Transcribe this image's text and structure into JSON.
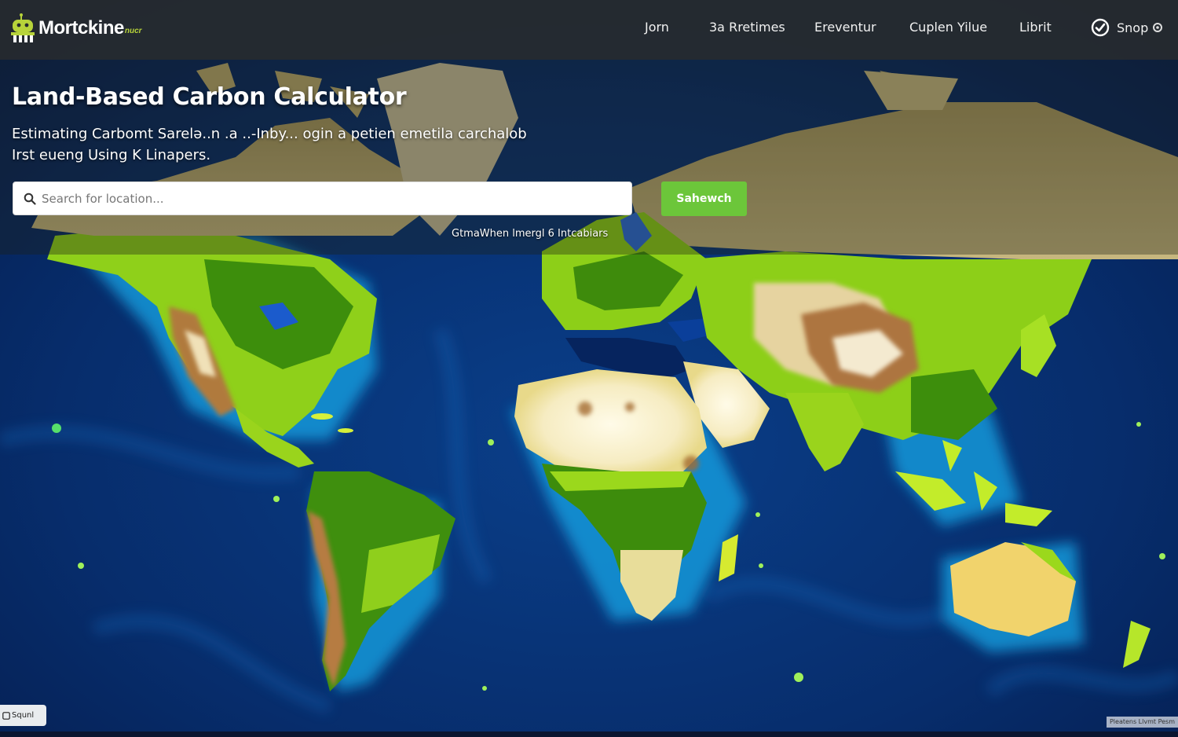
{
  "app": {
    "brand_name": "Mortckine",
    "brand_sub": "nucr"
  },
  "nav": {
    "items": [
      {
        "label": "Jorn"
      },
      {
        "label": "3a Rretimes"
      },
      {
        "label": "Ereventur"
      },
      {
        "label": "Cuplen Yilue"
      },
      {
        "label": "Librit"
      }
    ],
    "signin_label": "Snop"
  },
  "hero": {
    "title": "Land-Based Carbon Calculator",
    "subtitle_line1": "Estimating Carbomt  Sarelə..n .a ..-Inby... ogin a petien emetila carchalob",
    "subtitle_line2": "Irst eueng Using K Linapers."
  },
  "search": {
    "placeholder": "Search for location...",
    "value": "",
    "button_label": "Sahewch",
    "hint": "GtmaWhen lmergl 6 Intcabiars"
  },
  "map": {
    "zoom_chip_label": "Squnl",
    "attribution": "Pleatens Llvmt Pesm",
    "colors": {
      "ocean_deep": "#06245e",
      "ocean_mid": "#0a4fa0",
      "coast_glow": "#1aa8e8",
      "vegetation_dense": "#3a8c0a",
      "vegetation_bright": "#9bd81c",
      "desert": "#f4ecc8",
      "mountain": "#a8743a",
      "arctic": "#cbb98a"
    }
  },
  "colors": {
    "topbar": "#262a2e",
    "accent_green": "#6cc63a",
    "brand_yellow": "#b7d33a"
  }
}
